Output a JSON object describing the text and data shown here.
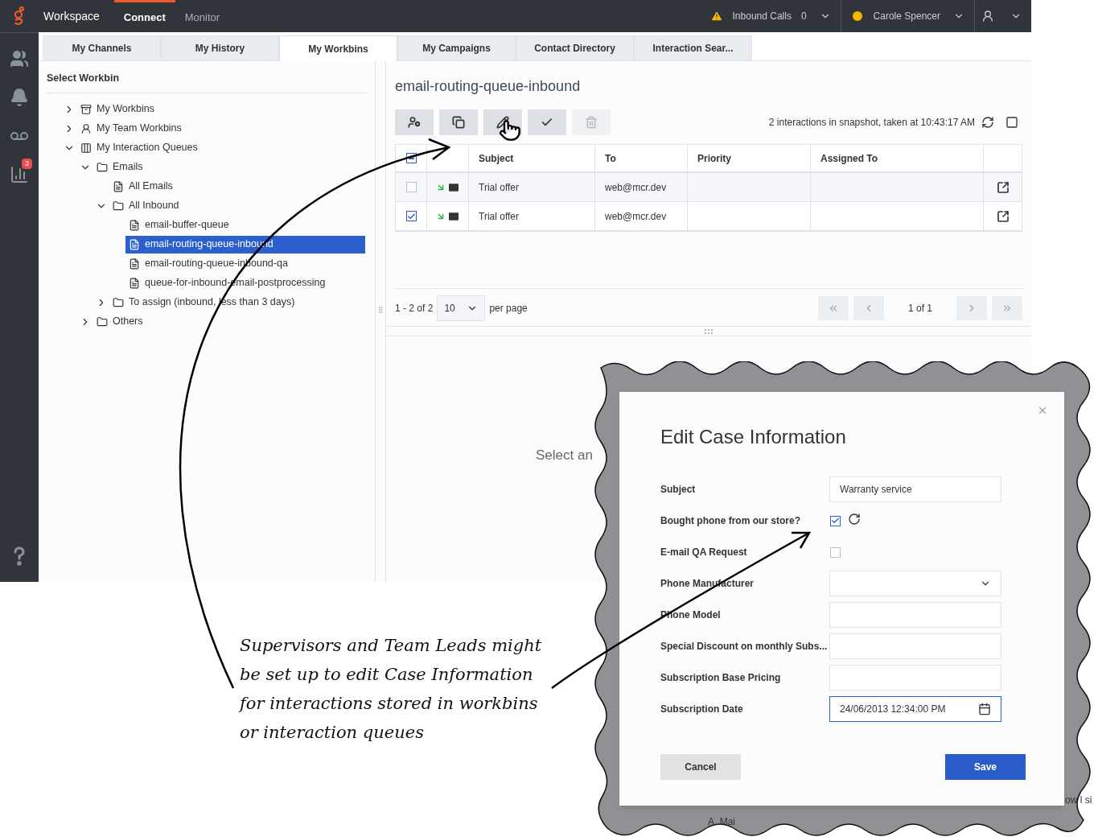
{
  "top_bar": {
    "app_title": "Workspace",
    "nav": [
      {
        "label": "Connect",
        "selected": true
      },
      {
        "label": "Monitor",
        "selected": false
      }
    ],
    "queue_label": "Inbound Calls",
    "queue_count": "0",
    "agent_name": "Carole Spencer"
  },
  "rail": [
    {
      "kind": "team"
    },
    {
      "kind": "bell"
    },
    {
      "kind": "voicemail"
    },
    {
      "kind": "stats",
      "badge": "3"
    },
    {
      "kind": "help"
    }
  ],
  "tabs": [
    {
      "label": "My Channels",
      "selected": false
    },
    {
      "label": "My History",
      "selected": false
    },
    {
      "label": "My Workbins",
      "selected": true
    },
    {
      "label": "My Campaigns",
      "selected": false
    },
    {
      "label": "Contact Directory",
      "selected": false
    },
    {
      "label": "Interaction Sear...",
      "selected": false
    }
  ],
  "workbin_panel": {
    "title": "Select Workbin",
    "tree": [
      {
        "label": "My Workbins",
        "kind": "workbins",
        "expanded": false,
        "selected": false
      },
      {
        "label": "My Team Workbins",
        "kind": "team",
        "expanded": false,
        "selected": false
      },
      {
        "label": "My Interaction Queues",
        "kind": "queues",
        "expanded": true,
        "selected": false,
        "children": [
          {
            "label": "Emails",
            "kind": "folder",
            "expanded": true,
            "selected": false,
            "children": [
              {
                "label": "All Emails",
                "kind": "queue",
                "selected": false
              },
              {
                "label": "All Inbound",
                "kind": "folder",
                "expanded": true,
                "selected": false,
                "children": [
                  {
                    "label": "email-buffer-queue",
                    "kind": "queue",
                    "selected": false
                  },
                  {
                    "label": "email-routing-queue-inbound",
                    "kind": "queue",
                    "selected": true
                  },
                  {
                    "label": "email-routing-queue-inbound-qa",
                    "kind": "queue",
                    "selected": false
                  },
                  {
                    "label": "queue-for-inbound-email-postprocessing",
                    "kind": "queue",
                    "selected": false
                  }
                ]
              },
              {
                "label": "To assign (inbound, less than 3 days)",
                "kind": "folder",
                "expanded": false,
                "selected": false
              }
            ]
          },
          {
            "label": "Others",
            "kind": "folder",
            "expanded": false,
            "selected": false
          }
        ]
      }
    ]
  },
  "workbin_view": {
    "title": "email-routing-queue-inbound",
    "toolbar": [
      {
        "kind": "assign",
        "disabled": false
      },
      {
        "kind": "move",
        "disabled": false
      },
      {
        "kind": "edit",
        "disabled": false
      },
      {
        "kind": "done",
        "disabled": false
      },
      {
        "kind": "delete",
        "disabled": true
      }
    ],
    "snapshot": "2 interactions in snapshot, taken at 10:43:17 AM",
    "header_partial": true,
    "columns": [
      "Subject",
      "To",
      "Priority",
      "Assigned To"
    ],
    "rows": [
      {
        "checked": false,
        "subject": "Trial offer",
        "to": "web@mcr.dev"
      },
      {
        "checked": true,
        "subject": "Trial offer",
        "to": "web@mcr.dev"
      }
    ],
    "range": "1 - 2 of 2",
    "page_size": "10",
    "per_page": "per page",
    "page": "1 of 1",
    "detail_text": "Select an"
  },
  "dialog": {
    "title": "Edit Case Information",
    "background_texts": [
      "A. Mai",
      "ow l si"
    ],
    "fields": [
      {
        "label": "Subject",
        "kind": "text",
        "value": "Warranty service"
      },
      {
        "label": "Bought phone from our store?",
        "kind": "checkbox",
        "checked": true
      },
      {
        "label": "E-mail QA Request",
        "kind": "checkbox",
        "checked": false
      },
      {
        "label": "Phone Manufacturer",
        "kind": "select"
      },
      {
        "label": "Phone Model",
        "kind": "text"
      },
      {
        "label": "Special Discount on monthly Subs...",
        "kind": "text"
      },
      {
        "label": "Subscription Base Pricing",
        "kind": "text"
      },
      {
        "label": "Subscription Date",
        "kind": "date",
        "value": "24/06/2013 12:34:00 PM"
      }
    ],
    "buttons": [
      {
        "label": "Cancel",
        "kind": "secondary"
      },
      {
        "label": "Save",
        "kind": "primary"
      }
    ]
  },
  "annotation": [
    "Supervisors and Team Leads might",
    "be set up to edit Case Information",
    "for interactions stored in workbins",
    "or interaction queues"
  ]
}
